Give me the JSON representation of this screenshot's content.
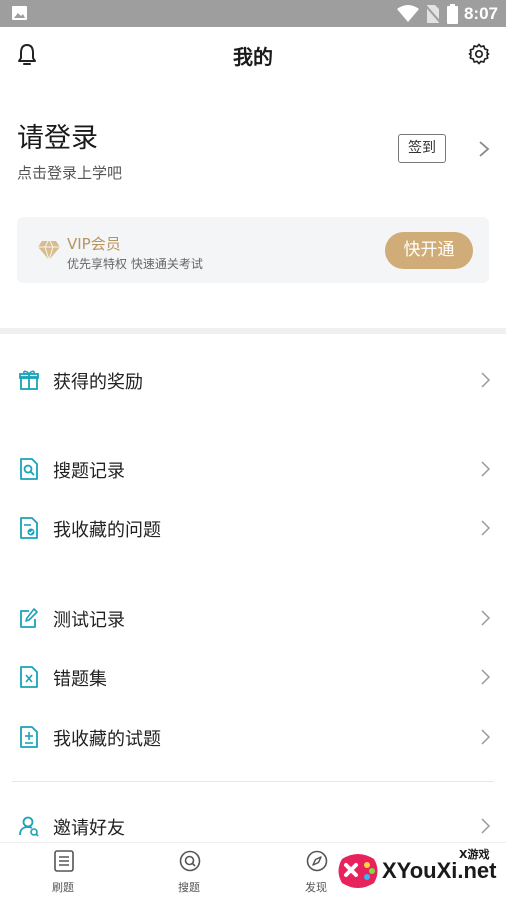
{
  "status_bar": {
    "time": "8:07"
  },
  "header": {
    "title": "我的"
  },
  "login": {
    "title": "请登录",
    "subtitle": "点击登录上学吧",
    "checkin_label": "签到"
  },
  "vip": {
    "title": "VIP会员",
    "subtitle": "优先享特权 快速通关考试",
    "button": "快开通"
  },
  "menu": {
    "rewards": "获得的奖励",
    "search_history": "搜题记录",
    "favorite_questions": "我收藏的问题",
    "test_records": "测试记录",
    "mistakes": "错题集",
    "favorite_tests": "我收藏的试题",
    "invite": "邀请好友"
  },
  "bottom_nav": {
    "practice": "刷题",
    "search": "搜题",
    "discover": "发现"
  },
  "watermark": {
    "text": "XYouXi.net",
    "small": "X游戏"
  },
  "colors": {
    "accent": "#1aa3b8",
    "gold": "#d0ad78",
    "gold_text": "#b8955f"
  }
}
